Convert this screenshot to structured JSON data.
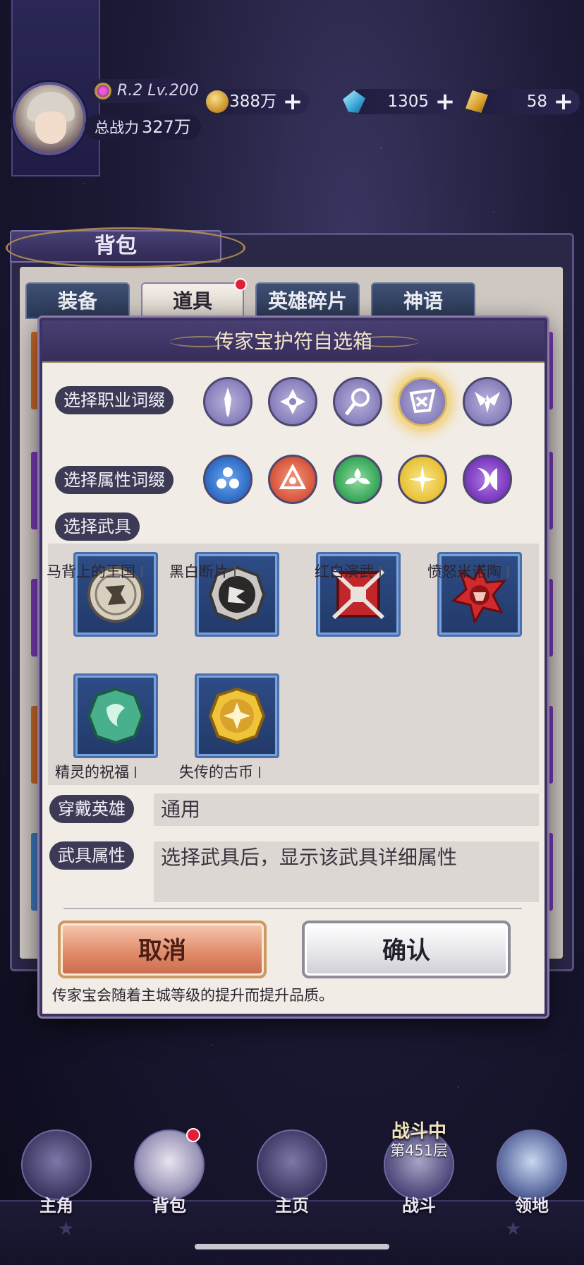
{
  "player": {
    "rank_level": "R.2 Lv.200",
    "power_label": "总战力",
    "power_value": "327万"
  },
  "resources": [
    {
      "icon": "gold-coin-icon",
      "value": "388万",
      "plus": "+"
    },
    {
      "icon": "crystal-icon",
      "value": "1305",
      "plus": "+"
    },
    {
      "icon": "gold-ticket-icon",
      "value": "58",
      "plus": "+"
    }
  ],
  "bag": {
    "title": "背包",
    "tabs": [
      "装备",
      "道具",
      "英雄碎片",
      "神语"
    ],
    "active_tab": "道具"
  },
  "dialog": {
    "title": "传家宝护符自选箱",
    "class_affix_label": "选择职业词缀",
    "attr_affix_label": "选择属性词缀",
    "weapon_label": "选择武具",
    "class_icons": [
      "sword-class-icon",
      "shuriken-class-icon",
      "staff-class-icon",
      "flag-class-icon",
      "wings-class-icon"
    ],
    "selected_class_index": 3,
    "attr_icons": [
      {
        "name": "water-attr-icon",
        "color": "#2f6fc8"
      },
      {
        "name": "fire-attr-icon",
        "color": "#d8583f"
      },
      {
        "name": "wind-attr-icon",
        "color": "#3aa85a"
      },
      {
        "name": "light-attr-icon",
        "color": "#e8c43a"
      },
      {
        "name": "dark-attr-icon",
        "color": "#7b3bbf"
      }
    ],
    "weapons": [
      {
        "name": "马背上的王国",
        "medal": "silver-horse-medal"
      },
      {
        "name": "黑白断片",
        "medal": "black-white-medal"
      },
      {
        "name": "红白演武",
        "medal": "red-white-crest"
      },
      {
        "name": "愤怒米诺陶",
        "medal": "red-minotaur-star"
      },
      {
        "name": "精灵的祝福",
        "medal": "jade-blessing-medal"
      },
      {
        "name": "失传的古币",
        "medal": "gold-ancient-coin"
      }
    ],
    "wear_hero_label": "穿戴英雄",
    "wear_hero_value": "通用",
    "weapon_attr_label": "武具属性",
    "weapon_attr_value": "选择武具后，显示该武具详细属性",
    "cancel_label": "取消",
    "confirm_label": "确认",
    "note": "传家宝会随着主城等级的提升而提升品质。"
  },
  "nav": {
    "items": [
      "主角",
      "背包",
      "主页",
      "战斗",
      "领地"
    ],
    "battle_status": "战斗中",
    "battle_floor": "第451层"
  }
}
